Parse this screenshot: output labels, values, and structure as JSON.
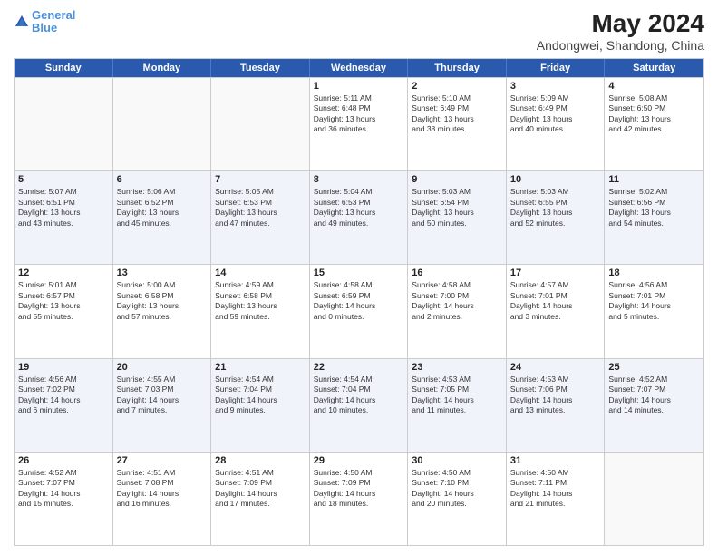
{
  "header": {
    "logo_line1": "General",
    "logo_line2": "Blue",
    "main_title": "May 2024",
    "subtitle": "Andongwei, Shandong, China"
  },
  "days": [
    "Sunday",
    "Monday",
    "Tuesday",
    "Wednesday",
    "Thursday",
    "Friday",
    "Saturday"
  ],
  "rows": [
    [
      {
        "day": "",
        "text": ""
      },
      {
        "day": "",
        "text": ""
      },
      {
        "day": "",
        "text": ""
      },
      {
        "day": "1",
        "text": "Sunrise: 5:11 AM\nSunset: 6:48 PM\nDaylight: 13 hours\nand 36 minutes."
      },
      {
        "day": "2",
        "text": "Sunrise: 5:10 AM\nSunset: 6:49 PM\nDaylight: 13 hours\nand 38 minutes."
      },
      {
        "day": "3",
        "text": "Sunrise: 5:09 AM\nSunset: 6:49 PM\nDaylight: 13 hours\nand 40 minutes."
      },
      {
        "day": "4",
        "text": "Sunrise: 5:08 AM\nSunset: 6:50 PM\nDaylight: 13 hours\nand 42 minutes."
      }
    ],
    [
      {
        "day": "5",
        "text": "Sunrise: 5:07 AM\nSunset: 6:51 PM\nDaylight: 13 hours\nand 43 minutes."
      },
      {
        "day": "6",
        "text": "Sunrise: 5:06 AM\nSunset: 6:52 PM\nDaylight: 13 hours\nand 45 minutes."
      },
      {
        "day": "7",
        "text": "Sunrise: 5:05 AM\nSunset: 6:53 PM\nDaylight: 13 hours\nand 47 minutes."
      },
      {
        "day": "8",
        "text": "Sunrise: 5:04 AM\nSunset: 6:53 PM\nDaylight: 13 hours\nand 49 minutes."
      },
      {
        "day": "9",
        "text": "Sunrise: 5:03 AM\nSunset: 6:54 PM\nDaylight: 13 hours\nand 50 minutes."
      },
      {
        "day": "10",
        "text": "Sunrise: 5:03 AM\nSunset: 6:55 PM\nDaylight: 13 hours\nand 52 minutes."
      },
      {
        "day": "11",
        "text": "Sunrise: 5:02 AM\nSunset: 6:56 PM\nDaylight: 13 hours\nand 54 minutes."
      }
    ],
    [
      {
        "day": "12",
        "text": "Sunrise: 5:01 AM\nSunset: 6:57 PM\nDaylight: 13 hours\nand 55 minutes."
      },
      {
        "day": "13",
        "text": "Sunrise: 5:00 AM\nSunset: 6:58 PM\nDaylight: 13 hours\nand 57 minutes."
      },
      {
        "day": "14",
        "text": "Sunrise: 4:59 AM\nSunset: 6:58 PM\nDaylight: 13 hours\nand 59 minutes."
      },
      {
        "day": "15",
        "text": "Sunrise: 4:58 AM\nSunset: 6:59 PM\nDaylight: 14 hours\nand 0 minutes."
      },
      {
        "day": "16",
        "text": "Sunrise: 4:58 AM\nSunset: 7:00 PM\nDaylight: 14 hours\nand 2 minutes."
      },
      {
        "day": "17",
        "text": "Sunrise: 4:57 AM\nSunset: 7:01 PM\nDaylight: 14 hours\nand 3 minutes."
      },
      {
        "day": "18",
        "text": "Sunrise: 4:56 AM\nSunset: 7:01 PM\nDaylight: 14 hours\nand 5 minutes."
      }
    ],
    [
      {
        "day": "19",
        "text": "Sunrise: 4:56 AM\nSunset: 7:02 PM\nDaylight: 14 hours\nand 6 minutes."
      },
      {
        "day": "20",
        "text": "Sunrise: 4:55 AM\nSunset: 7:03 PM\nDaylight: 14 hours\nand 7 minutes."
      },
      {
        "day": "21",
        "text": "Sunrise: 4:54 AM\nSunset: 7:04 PM\nDaylight: 14 hours\nand 9 minutes."
      },
      {
        "day": "22",
        "text": "Sunrise: 4:54 AM\nSunset: 7:04 PM\nDaylight: 14 hours\nand 10 minutes."
      },
      {
        "day": "23",
        "text": "Sunrise: 4:53 AM\nSunset: 7:05 PM\nDaylight: 14 hours\nand 11 minutes."
      },
      {
        "day": "24",
        "text": "Sunrise: 4:53 AM\nSunset: 7:06 PM\nDaylight: 14 hours\nand 13 minutes."
      },
      {
        "day": "25",
        "text": "Sunrise: 4:52 AM\nSunset: 7:07 PM\nDaylight: 14 hours\nand 14 minutes."
      }
    ],
    [
      {
        "day": "26",
        "text": "Sunrise: 4:52 AM\nSunset: 7:07 PM\nDaylight: 14 hours\nand 15 minutes."
      },
      {
        "day": "27",
        "text": "Sunrise: 4:51 AM\nSunset: 7:08 PM\nDaylight: 14 hours\nand 16 minutes."
      },
      {
        "day": "28",
        "text": "Sunrise: 4:51 AM\nSunset: 7:09 PM\nDaylight: 14 hours\nand 17 minutes."
      },
      {
        "day": "29",
        "text": "Sunrise: 4:50 AM\nSunset: 7:09 PM\nDaylight: 14 hours\nand 18 minutes."
      },
      {
        "day": "30",
        "text": "Sunrise: 4:50 AM\nSunset: 7:10 PM\nDaylight: 14 hours\nand 20 minutes."
      },
      {
        "day": "31",
        "text": "Sunrise: 4:50 AM\nSunset: 7:11 PM\nDaylight: 14 hours\nand 21 minutes."
      },
      {
        "day": "",
        "text": ""
      }
    ]
  ]
}
